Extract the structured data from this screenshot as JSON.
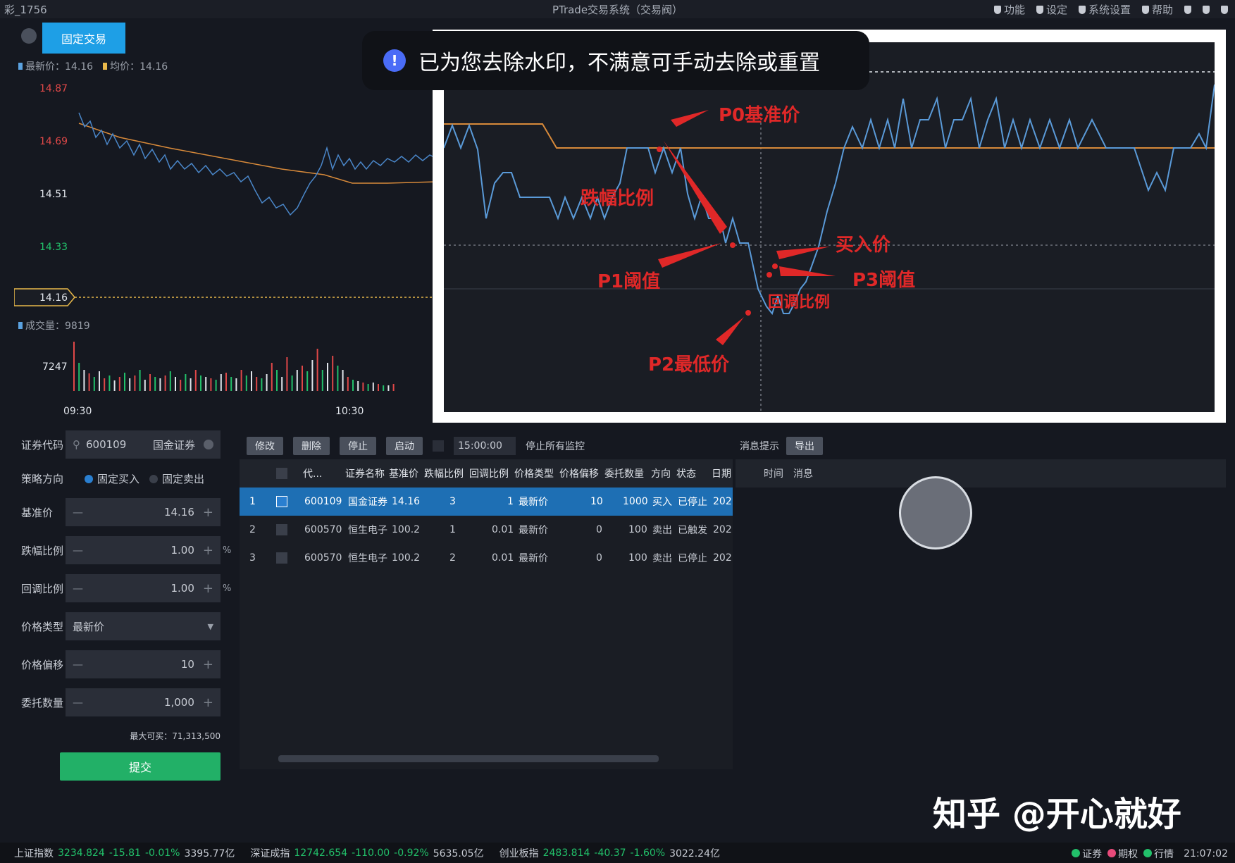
{
  "window": {
    "app_id": "彩_1756",
    "title": "PTrade交易系统（交易阀）",
    "menu": [
      "功能",
      "设定",
      "系统设置",
      "帮助"
    ]
  },
  "chart": {
    "tab_label": "固定交易",
    "legend": {
      "latest": "最新价：14.16",
      "avg": "均价：14.16"
    },
    "price_ticks": [
      "14.87",
      "14.69",
      "14.51",
      "14.33",
      "14.16"
    ],
    "volume_label": "成交量：9819",
    "volume_tick": "7247",
    "time_ticks": [
      "09:30",
      "10:30"
    ],
    "colors": {
      "price_line": "#4a86c8",
      "avg_line": "#d88a3a",
      "up_tick": "#e04848",
      "down_tick": "#22c06a",
      "ref_line": "#e8b84a"
    }
  },
  "annotation": {
    "labels": {
      "p0": "P0基准价",
      "drop_ratio": "跌幅比例",
      "buy_price": "买入价",
      "p1": "P1阈值",
      "p3": "P3阈值",
      "rebound_ratio": "回调比例",
      "p2": "P2最低价"
    },
    "colors": {
      "label": "#e02828",
      "line": "#5a9ad8",
      "base": "#d88a3a",
      "grid": "#3a3f4a"
    }
  },
  "toast": {
    "icon": "!",
    "text": "已为您去除水印，不满意可手动去除或重置"
  },
  "order_form": {
    "code_label": "证券代码",
    "code_value": "600109",
    "code_name": "国金证券",
    "strategy_label": "策略方向",
    "buy_option": "固定买入",
    "sell_option": "固定卖出",
    "base_price_label": "基准价",
    "base_price_value": "14.16",
    "drop_ratio_label": "跌幅比例",
    "drop_ratio_value": "1.00",
    "rebound_ratio_label": "回调比例",
    "rebound_ratio_value": "1.00",
    "pct_unit": "%",
    "price_type_label": "价格类型",
    "price_type_value": "最新价",
    "price_offset_label": "价格偏移",
    "price_offset_value": "10",
    "entrust_qty_label": "委托数量",
    "entrust_qty_value": "1,000",
    "max_qty_text": "最大可买：71,313,500",
    "submit_label": "提交"
  },
  "task_panel": {
    "buttons": [
      "修改",
      "删除",
      "停止",
      "启动"
    ],
    "time_value": "15:00:00",
    "stop_all_label": "停止所有监控",
    "headers": [
      "代...",
      "证券名称",
      "基准价",
      "跌幅比例",
      "回调比例",
      "价格类型",
      "价格偏移",
      "委托数量",
      "方向",
      "状态",
      "日期"
    ],
    "rows": [
      {
        "no": "1",
        "code": "600109",
        "name": "国金证券",
        "base": "14.16",
        "drop": "3",
        "rebound": "1",
        "ptype": "最新价",
        "offset": "10",
        "qty": "1000",
        "dir": "买入",
        "status": "已停止",
        "date": "202"
      },
      {
        "no": "2",
        "code": "600570",
        "name": "恒生电子",
        "base": "100.2",
        "drop": "1",
        "rebound": "0.01",
        "ptype": "最新价",
        "offset": "0",
        "qty": "100",
        "dir": "卖出",
        "status": "已触发",
        "date": "202"
      },
      {
        "no": "3",
        "code": "600570",
        "name": "恒生电子",
        "base": "100.2",
        "drop": "2",
        "rebound": "0.01",
        "ptype": "最新价",
        "offset": "0",
        "qty": "100",
        "dir": "卖出",
        "status": "已停止",
        "date": "202"
      }
    ]
  },
  "msg_panel": {
    "title": "消息提示",
    "export_label": "导出",
    "cols": [
      "时间",
      "消息"
    ]
  },
  "watermark": "知乎 @开心就好",
  "statusbar": {
    "sh_label": "上证指数",
    "sh_value": "3234.824",
    "sh_change": "-15.81",
    "sh_pct": "-0.01%",
    "sh_amount": "3395.77亿",
    "sz_label": "深证成指",
    "sz_value": "12742.654",
    "sz_change": "-110.00",
    "sz_pct": "-0.92%",
    "sz_amount": "5635.05亿",
    "cy_label": "创业板指",
    "cy_value": "2483.814",
    "cy_change": "-40.37",
    "cy_pct": "-1.60%",
    "cy_amount": "3022.24亿",
    "indicators": [
      "证券",
      "期权",
      "行情"
    ],
    "time": "21:07:02"
  }
}
